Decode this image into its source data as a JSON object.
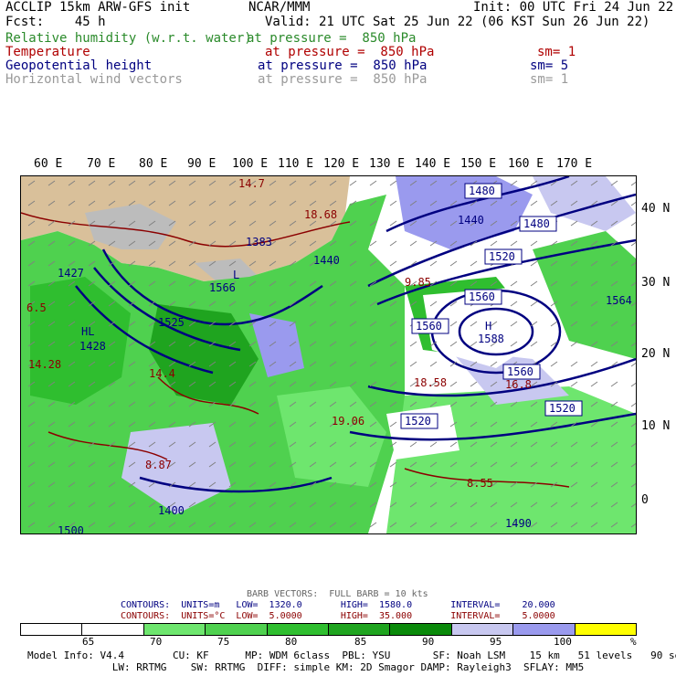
{
  "header": {
    "line1_left": "ACCLIP 15km ARW-GFS init",
    "line1_mid": "NCAR/MMM",
    "line1_right": "Init: 00 UTC Fri 24 Jun 22",
    "fcst": "Fcst:    45 h",
    "valid": "Valid: 21 UTC Sat 25 Jun 22 (06 KST Sun 26 Jun 22)",
    "fields": [
      {
        "name": "Relative humidity (w.r.t. water)",
        "pressure": "at pressure =  850 hPa",
        "sm": "",
        "color": "#2a8a2a"
      },
      {
        "name": "Temperature",
        "pressure": "at pressure =  850 hPa",
        "sm": "sm= 1",
        "color": "#b00000"
      },
      {
        "name": "Geopotential height",
        "pressure": "at pressure =  850 hPa",
        "sm": "sm= 5",
        "color": "#000080"
      },
      {
        "name": "Horizontal wind vectors",
        "pressure": "at pressure =  850 hPa",
        "sm": "sm= 1",
        "color": "#9a9a9a"
      }
    ]
  },
  "map": {
    "lon_labels": [
      "60 E",
      "70 E",
      "80 E",
      "90 E",
      "100 E",
      "110 E",
      "120 E",
      "130 E",
      "140 E",
      "150 E",
      "160 E",
      "170 E"
    ],
    "lat_labels": [
      "40 N",
      "30 N",
      "20 N",
      "10 N",
      "0"
    ],
    "height_labels": [
      "1588",
      "1560",
      "1560",
      "1560",
      "1520",
      "1520",
      "1520",
      "1480",
      "1480",
      "1440",
      "1440",
      "1427",
      "1428",
      "1500",
      "1564",
      "1383",
      "1566",
      "1525",
      "1400",
      "1490"
    ],
    "temp_labels": [
      "18.68",
      "18.58",
      "16.8",
      "19.06",
      "6.5",
      "8.87",
      "9.85",
      "8.55",
      "14.4",
      "14.7",
      "14.28"
    ],
    "colors": {
      "land": "#d9c09a",
      "height_contour": "#000080",
      "temp_contour": "#8b0000",
      "wind": "#808080",
      "terrain_gray": "#bcbcbc"
    }
  },
  "footer": {
    "barb": "BARB VECTORS:  FULL BARB = 10 kts",
    "contours1": "CONTOURS:  UNITS=m   LOW=  1320.0       HIGH=  1580.0       INTERVAL=    20.000",
    "contours2": "CONTOURS:  UNITS=°C  LOW=  5.0000       HIGH=  35.000       INTERVAL=    5.0000",
    "scale_ticks": [
      "65",
      "70",
      "75",
      "80",
      "85",
      "90",
      "95",
      "100",
      "%"
    ],
    "scale_colors": [
      "#ffffff",
      "#ffffff",
      "#6ee66e",
      "#4fd14f",
      "#2fbe2f",
      "#1fa41f",
      "#0a8a0a",
      "#c8c8f0",
      "#9a9aee",
      "#ffff00"
    ],
    "model_info1": "Model Info: V4.4        CU: KF      MP: WDM 6class  PBL: YSU       SF: Noah LSM    15 km   51 levels   90 sec",
    "model_info2": "              LW: RRTMG    SW: RRTMG  DIFF: simple KM: 2D Smagor DAMP: Rayleigh3  SFLAY: MM5"
  }
}
